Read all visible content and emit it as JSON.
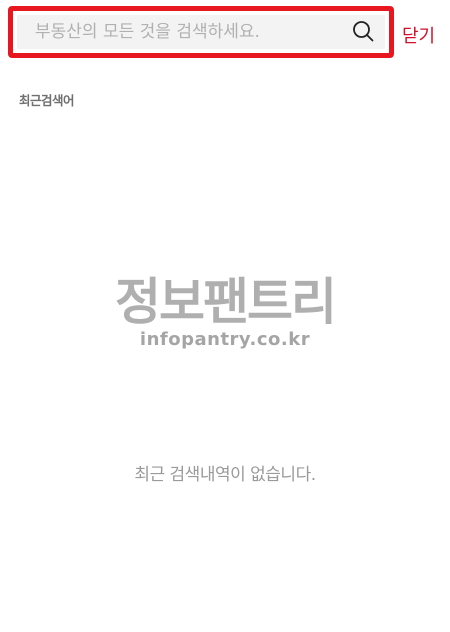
{
  "search": {
    "placeholder": "부동산의 모든 것을 검색하세요.",
    "value": ""
  },
  "header": {
    "close_label": "닫기",
    "close_color": "#d3102b",
    "highlight_border_color": "#e8161e"
  },
  "recent": {
    "heading": "최근검색어",
    "empty_message": "최근 검색내역이 없습니다."
  },
  "watermark": {
    "main": "정보팬트리",
    "sub": "infopantry.co.kr"
  }
}
